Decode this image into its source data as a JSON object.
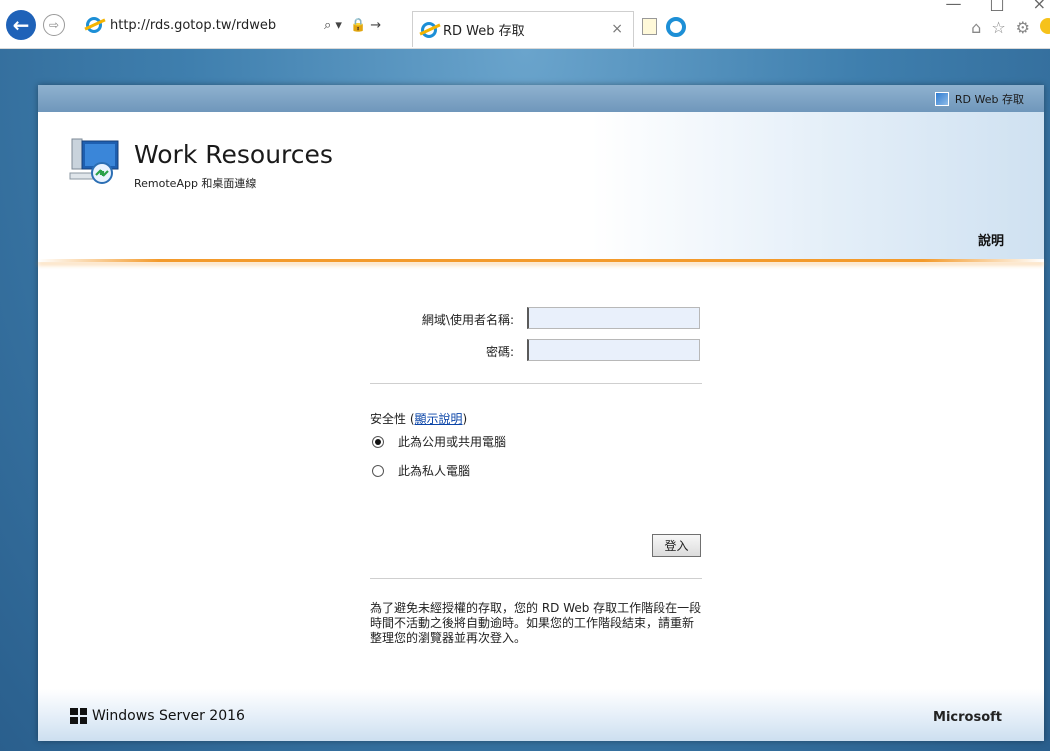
{
  "browser": {
    "url": "http://rds.gotop.tw/rdweb",
    "tab_title": "RD Web 存取",
    "addr_search_glyph": "⌕ ▾",
    "addr_lock_glyph": "🔒 →",
    "tab_close_glyph": "×",
    "back_glyph": "←",
    "forward_glyph": "⇨",
    "home_glyph": "⌂",
    "favorites_glyph": "☆",
    "settings_glyph": "⚙",
    "minimize_glyph": "—",
    "maximize_glyph": "□",
    "close_glyph": "×"
  },
  "topbar": {
    "label": "RD Web 存取"
  },
  "header": {
    "title": "Work Resources",
    "subtitle": "RemoteApp 和桌面連線",
    "help": "說明"
  },
  "login": {
    "username_label": "網域\\使用者名稱:",
    "username_value": "",
    "password_label": "密碼:",
    "password_value": "",
    "security_label": "安全性 (",
    "security_link": "顯示說明",
    "security_close": ")",
    "options": [
      "此為公用或共用電腦",
      "此為私人電腦"
    ],
    "selected": "此為公用或共用電腦",
    "signin": "登入",
    "notice": "為了避免未經授權的存取，您的 RD Web 存取工作階段在一段時間不活動之後將自動逾時。如果您的工作階段結束，請重新整理您的瀏覽器並再次登入。"
  },
  "footer": {
    "product": "Windows Server 2016",
    "vendor": "Microsoft"
  },
  "colors": {
    "accent_orange": "#f39a2b",
    "link_blue": "#0b45a8",
    "page_blue": "#3f7fae"
  }
}
